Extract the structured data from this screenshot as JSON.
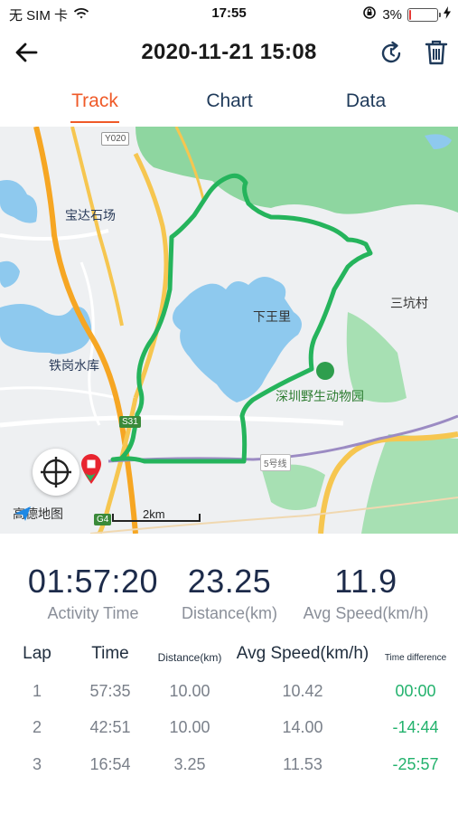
{
  "status_bar": {
    "carrier": "无 SIM 卡",
    "time": "17:55",
    "battery": "3%",
    "battery_level": 0.03
  },
  "header": {
    "title": "2020-11-21 15:08"
  },
  "tabs": [
    {
      "label": "Track",
      "active": true
    },
    {
      "label": "Chart",
      "active": false
    },
    {
      "label": "Data",
      "active": false
    }
  ],
  "map": {
    "labels": {
      "baoda": "宝达石场",
      "tiegang": "铁岗水库",
      "xiawangli": "下王里",
      "sankeng": "三坑村",
      "zoo": "深圳野生动物园"
    },
    "shields": {
      "y020": "Y020",
      "s31": "S31",
      "line5": "5号线",
      "g4": "G4"
    },
    "scale": "2km",
    "brand": "高德地图",
    "colors": {
      "route": "#25b45c",
      "water": "#8ec9ee",
      "park": "#8ed6a0",
      "road_major": "#f6a623"
    }
  },
  "stats": {
    "activity_time": {
      "value": "01:57:20",
      "label": "Activity Time"
    },
    "distance": {
      "value": "23.25",
      "label": "Distance(km)"
    },
    "avg_speed": {
      "value": "11.9",
      "label": "Avg Speed(km/h)"
    }
  },
  "laps": {
    "headers": {
      "lap": "Lap",
      "time": "Time",
      "distance": "Distance(km)",
      "avg_speed": "Avg Speed(km/h)",
      "time_diff": "Time difference"
    },
    "rows": [
      {
        "lap": "1",
        "time": "57:35",
        "distance": "10.00",
        "avg_speed": "10.42",
        "diff": "00:00"
      },
      {
        "lap": "2",
        "time": "42:51",
        "distance": "10.00",
        "avg_speed": "14.00",
        "diff": "-14:44"
      },
      {
        "lap": "3",
        "time": "16:54",
        "distance": "3.25",
        "avg_speed": "11.53",
        "diff": "-25:57"
      }
    ]
  }
}
